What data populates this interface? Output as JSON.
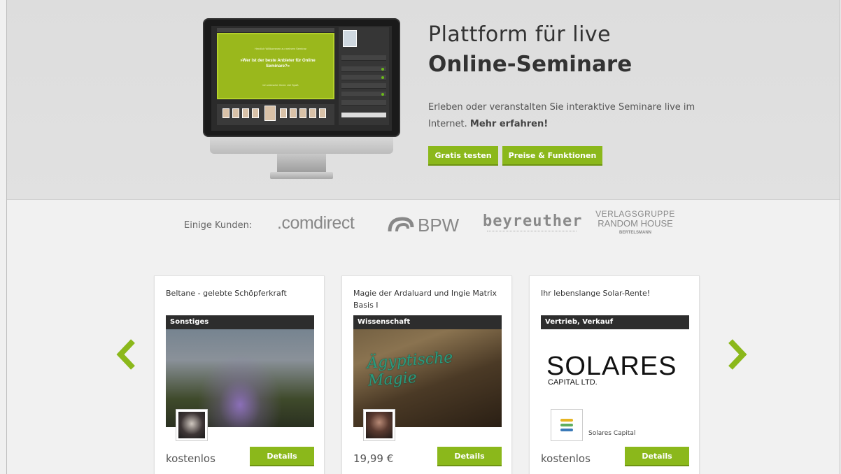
{
  "hero": {
    "title_line1": "Plattform für live",
    "title_line2": "Online-Seminare",
    "description": "Erleben oder veranstalten Sie interaktive Seminare live im Internet.",
    "more_link": "Mehr erfahren!",
    "btn_trial": "Gratis testen",
    "btn_pricing": "Preise & Funktionen",
    "screen": {
      "welcome_text": "Herzlich Willkommen zu meinem Seminar",
      "question": "»Wer ist der beste Anbieter für Online Seminare?«",
      "footer_text": "Ich wünsche Ihnen viel Spaß"
    }
  },
  "customers": {
    "label": "Einige Kunden:",
    "logos": {
      "comdirect": ".comdirect",
      "bpw": "BPW",
      "beyreuther": "beyreuther",
      "rh_line1": "VERLAGSGRUPPE",
      "rh_line2": "RANDOM HOUSE",
      "rh_line3": "BERTELSMANN"
    }
  },
  "carousel": {
    "cards": [
      {
        "title": "Beltane - gelebte Schöpferkraft",
        "category": "Sonstiges",
        "price": "kostenlos",
        "button": "Details"
      },
      {
        "title": "Magie der Ardaluard und Ingie Matrix Basis I",
        "category": "Wissenschaft",
        "image_text": "Ägyptische Magie",
        "price": "19,99 €",
        "button": "Details"
      },
      {
        "title": "Ihr lebenslange Solar-Rente!",
        "category": "Vertrieb, Verkauf",
        "logo_text": "SOLARES",
        "logo_sub": "CAPITAL LTD.",
        "vendor": "Solares Capital",
        "price": "kostenlos",
        "button": "Details"
      }
    ]
  },
  "colors": {
    "accent": "#8bb81b",
    "dark_bar": "#2d2d2d"
  },
  "icons": {
    "prev": "chevron-left-icon",
    "next": "chevron-right-icon"
  }
}
